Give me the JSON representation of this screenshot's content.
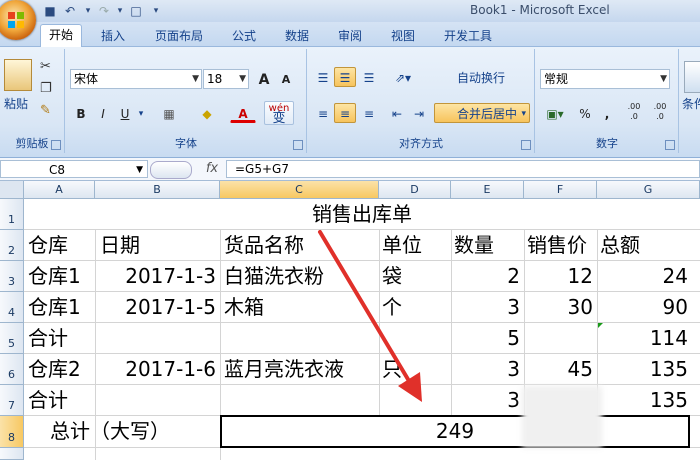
{
  "window": {
    "title": "Book1 - Microsoft Excel"
  },
  "tabs": [
    "开始",
    "插入",
    "页面布局",
    "公式",
    "数据",
    "审阅",
    "视图",
    "开发工具"
  ],
  "ribbon": {
    "clipboard": {
      "label": "剪贴板",
      "paste": "粘贴"
    },
    "font": {
      "label": "字体",
      "name": "宋体",
      "size": "18",
      "bold": "B",
      "italic": "I",
      "underline": "U",
      "grow": "A",
      "shrink": "A",
      "wen": "wén",
      "wen_char": "变"
    },
    "alignment": {
      "label": "对齐方式",
      "wrap": "自动换行",
      "merge": "合并后居中"
    },
    "number": {
      "label": "数字",
      "format": "常规",
      "percent": "%",
      "comma": ",",
      "inc": ".00 .0",
      "dec": ".00 .0"
    },
    "styles": {
      "label": "条件"
    }
  },
  "formula_bar": {
    "name_box": "C8",
    "fx": "fx",
    "formula": "=G5+G7"
  },
  "columns": [
    "A",
    "B",
    "C",
    "D",
    "E",
    "F",
    "G"
  ],
  "rows": [
    "1",
    "2",
    "3",
    "4",
    "5",
    "6",
    "7",
    "8"
  ],
  "sheet": {
    "title": "销售出库单",
    "headers": [
      "仓库",
      "日期",
      "货品名称",
      "单位",
      "数量",
      "销售价",
      "总额"
    ],
    "r3": [
      "仓库1",
      "2017-1-3",
      "白猫洗衣粉",
      "袋",
      "2",
      "12",
      "24"
    ],
    "r4": [
      "仓库1",
      "2017-1-5",
      "木箱",
      "个",
      "3",
      "30",
      "90"
    ],
    "r5": [
      "合计",
      "5",
      "114"
    ],
    "r6": [
      "仓库2",
      "2017-1-6",
      "蓝月亮洗衣液",
      "只",
      "3",
      "45",
      "135"
    ],
    "r7": [
      "合计",
      "3",
      "135"
    ],
    "r8": [
      "总计（大写）",
      "249"
    ]
  },
  "colors": {
    "accent": "#15428b",
    "arrow": "#e0302a"
  }
}
